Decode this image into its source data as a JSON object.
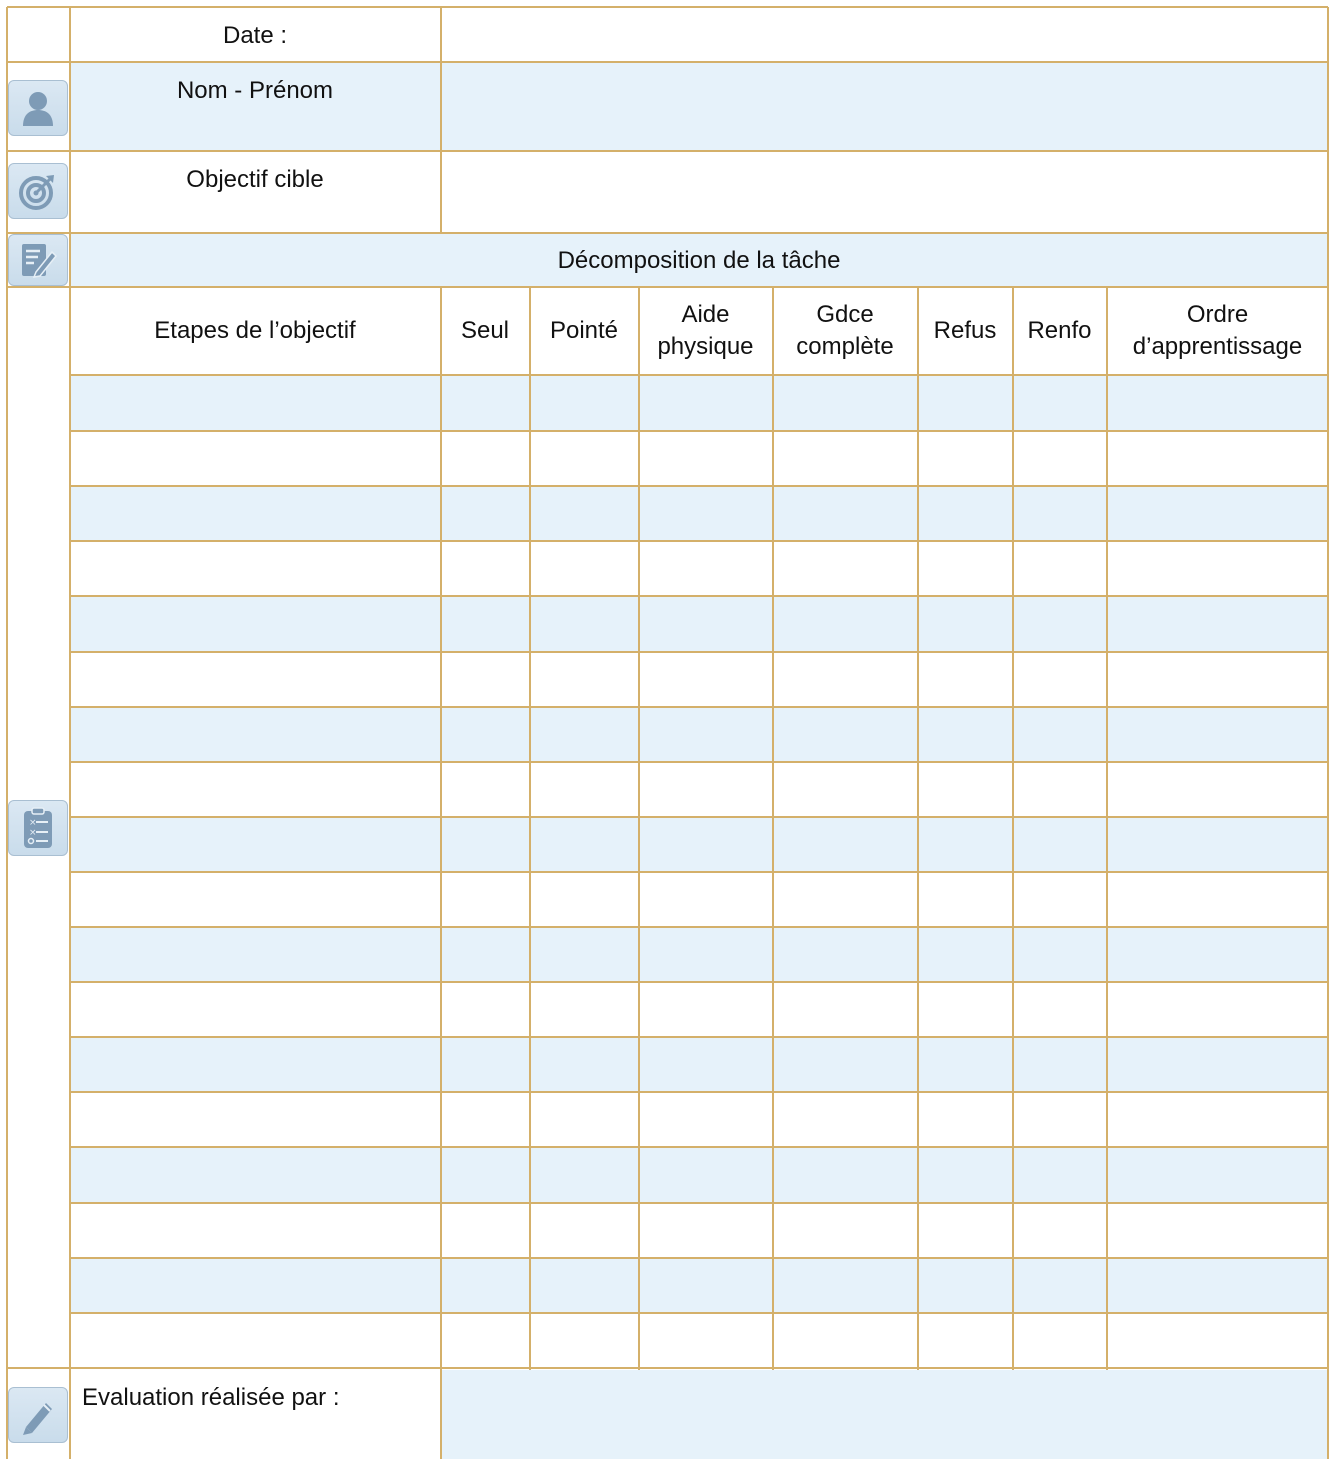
{
  "header": {
    "date_label": "Date :",
    "name_label": "Nom - Prénom",
    "objective_label": "Objectif cible",
    "decomposition_title": "Décomposition de la tâche"
  },
  "table": {
    "columns": [
      "Etapes de l’objectif",
      "Seul",
      "Pointé",
      "Aide physique",
      "Gdce complète",
      "Refus",
      "Renfo",
      "Ordre d’apprentissage"
    ],
    "row_count": 18
  },
  "footer": {
    "evaluator_label": "Evaluation réalisée par :"
  },
  "icons": {
    "person": "person-icon",
    "target": "target-icon",
    "edit_document": "edit-document-icon",
    "checklist": "checklist-icon",
    "pencil": "pencil-icon"
  },
  "colors": {
    "grid_line": "#d4b06a",
    "band_fill": "#e6f2fa",
    "icon_fill": "#7e9bb6"
  }
}
